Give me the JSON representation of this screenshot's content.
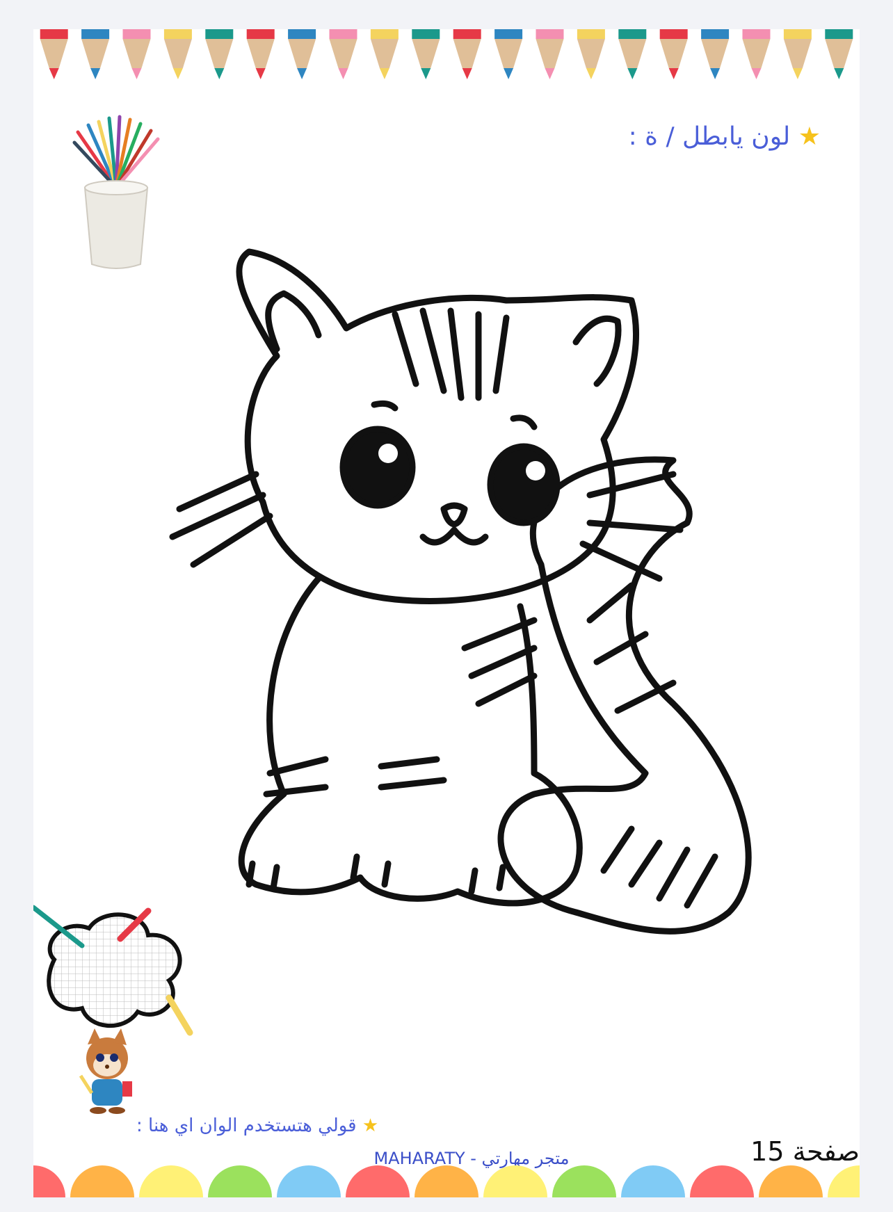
{
  "header": {
    "title": "لون يابطل / ة :",
    "star_icon": "star-icon"
  },
  "prompt": {
    "text": "قولي هتستخدم الوان اي هنا :",
    "star_icon": "star-icon"
  },
  "footer": {
    "store": "متجر مهارتي - MAHARATY",
    "page_label": "صفحة 15"
  },
  "colors": {
    "title": "#4a5ed8",
    "pencil_tips": [
      "#e63946",
      "#2e86c1",
      "#f48fb1",
      "#f4d35e",
      "#1b998b",
      "#e63946",
      "#2e86c1",
      "#f48fb1",
      "#f4d35e",
      "#1b998b",
      "#e63946",
      "#2e86c1",
      "#f48fb1",
      "#f4d35e",
      "#1b998b",
      "#e63946",
      "#2e86c1",
      "#f48fb1",
      "#f4d35e",
      "#1b998b"
    ],
    "circles": [
      "#ff6b6b",
      "#ffb347",
      "#fff176",
      "#9be15d",
      "#80cbf5",
      "#ff6b6b",
      "#ffb347",
      "#fff176",
      "#9be15d",
      "#80cbf5",
      "#ff6b6b",
      "#ffb347",
      "#fff176"
    ]
  },
  "illustrations": [
    "pencil-cup-icon",
    "cat-line-art",
    "thought-cloud-icon",
    "squirrel-mascot-icon"
  ]
}
